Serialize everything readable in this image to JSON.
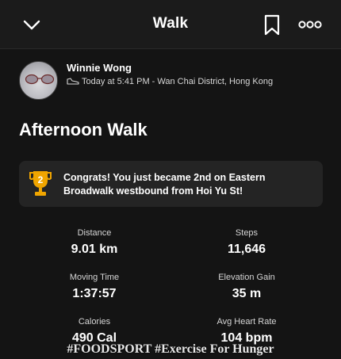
{
  "header": {
    "title": "Walk",
    "back_icon": "chevron-down-icon",
    "bookmark_icon": "bookmark-icon",
    "more_icon": "more-dots-icon"
  },
  "athlete": {
    "name": "Winnie Wong",
    "activity_meta": "Today at 5:41 PM - Wan Chai District, Hong Kong",
    "meta_icon": "shoe-icon"
  },
  "activity": {
    "title": "Afternoon Walk"
  },
  "achievement": {
    "text": "Congrats! You just became 2nd on Eastern Broadwalk westbound from Hoi Yu St!",
    "rank": "2",
    "trophy_color": "#f0a500",
    "icon": "trophy-icon"
  },
  "stats": [
    {
      "label": "Distance",
      "value": "9.01 km"
    },
    {
      "label": "Steps",
      "value": "11,646"
    },
    {
      "label": "Moving Time",
      "value": "1:37:57"
    },
    {
      "label": "Elevation Gain",
      "value": "35 m"
    },
    {
      "label": "Calories",
      "value": "490 Cal"
    },
    {
      "label": "Avg Heart Rate",
      "value": "104 bpm"
    }
  ],
  "watermark": "#FOODSPORT #Exercise For Hunger"
}
